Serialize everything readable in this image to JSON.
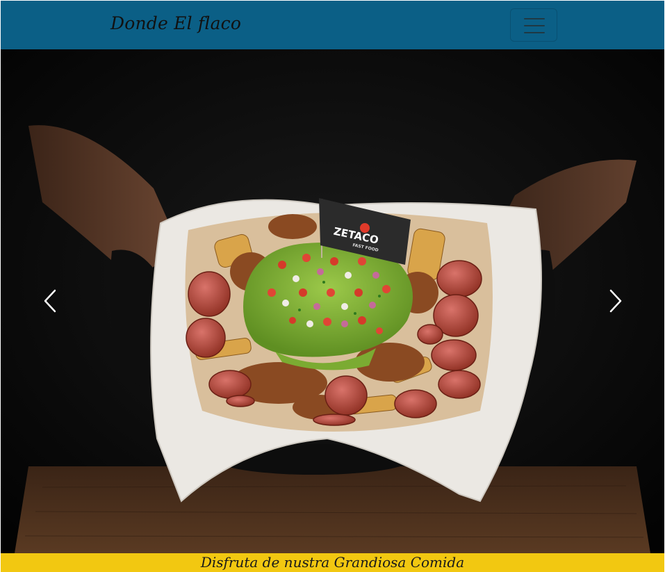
{
  "navbar": {
    "brand": "Donde El flaco",
    "toggler_icon": "hamburger-icon",
    "background_color": "#0b5f86"
  },
  "hero": {
    "flag_brand": "ZETACO",
    "flag_sub": "FAST FOOD",
    "prev_icon": "chevron-left-icon",
    "next_icon": "chevron-right-icon"
  },
  "caption": {
    "text": "Disfruta de nustra Grandiosa Comida",
    "background_color": "#f2c811"
  }
}
